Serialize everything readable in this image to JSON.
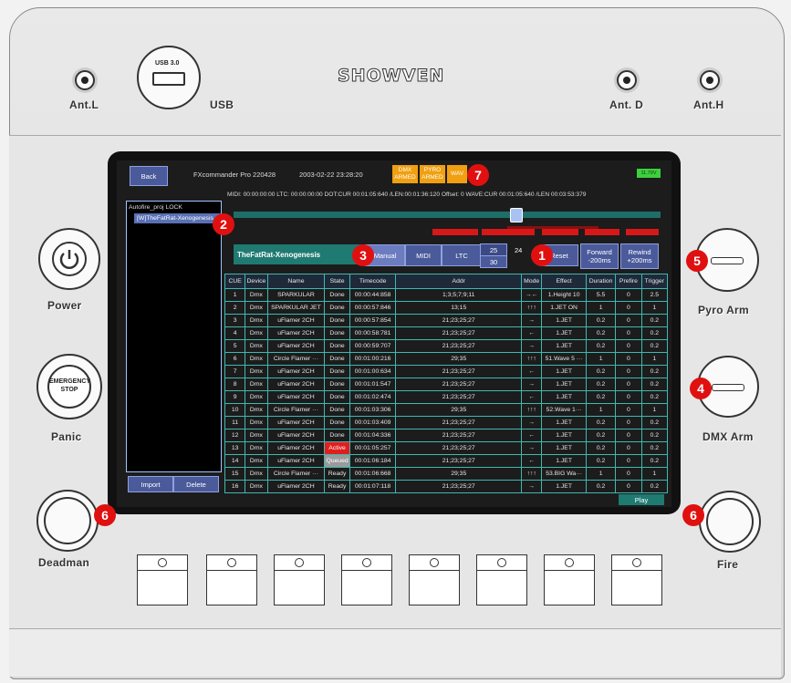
{
  "hardware": {
    "brand": "SHOWVEN",
    "usb_port_text": "USB 3.0",
    "labels": {
      "ant_l": "Ant.L",
      "usb": "USB",
      "ant_d": "Ant. D",
      "ant_h": "Ant.H",
      "power": "Power",
      "panic": "Panic",
      "panic_button_text": "EMERGENCY STOP",
      "deadman": "Deadman",
      "pyro_arm": "Pyro Arm",
      "dmx_arm": "DMX Arm",
      "fire": "Fire"
    },
    "markers": {
      "m1": "1",
      "m2": "2",
      "m3": "3",
      "m4": "4",
      "m5": "5",
      "m6": "6",
      "m7": "7"
    }
  },
  "screen": {
    "back_label": "Back",
    "app_title": "FXcommander Pro 220428",
    "datetime": "2003-02-22 23:28:20",
    "dmx_armed": "DMX ARMED",
    "pyro_armed": "PYRO ARMED",
    "wave": "WAV",
    "battery": "11.79V",
    "status_line": "MIDI: 00:00:00:00  LTC: 00:00:00:00 DOT:CUR 00:01:05:640 /LEN:00:01:36:120  Offset: 0    WAVE:CUR  00:01:05:640 /LEN 00:03:53:379",
    "project": {
      "name": "Autofire_proj",
      "lock": "LOCK",
      "item": "[W]TheFatRat-Xenogenesis"
    },
    "import_label": "Import",
    "delete_label": "Delete",
    "song_title": "TheFatRat-Xenogenesis",
    "modes": {
      "manual": "Manual",
      "midi": "MIDI",
      "ltc": "LTC"
    },
    "fps": {
      "f25": "25",
      "f24": "24",
      "f30": "30"
    },
    "reset_label": "Reset",
    "forward_label_1": "Forward",
    "forward_label_2": "-200ms",
    "rewind_label_1": "Rewind",
    "rewind_label_2": "+200ms",
    "play_label": "Play",
    "playhead_position": 0.66,
    "columns": [
      "CUE",
      "Device",
      "Name",
      "State",
      "Timecode",
      "Addr",
      "Mode",
      "Effect",
      "Duration",
      "Prefire",
      "Trigger"
    ],
    "rows": [
      [
        "1",
        "Dmx",
        "SPARKULAR",
        "Done",
        "00:00:44:858",
        "1;3;5;7;9;11",
        "→←",
        "1.Height 10",
        "5.5",
        "0",
        "2.5"
      ],
      [
        "2",
        "Dmx",
        "SPARKULAR JET",
        "Done",
        "00:00:57:846",
        "13;15",
        "↑↑↑",
        "1.JET ON",
        "1",
        "0",
        "1"
      ],
      [
        "3",
        "Dmx",
        "uFlamer 2CH",
        "Done",
        "00:00:57:854",
        "21;23;25;27",
        "→",
        "1.JET",
        "0.2",
        "0",
        "0.2"
      ],
      [
        "4",
        "Dmx",
        "uFlamer 2CH",
        "Done",
        "00:00:58:781",
        "21;23;25;27",
        "←",
        "1.JET",
        "0.2",
        "0",
        "0.2"
      ],
      [
        "5",
        "Dmx",
        "uFlamer 2CH",
        "Done",
        "00:00:59:707",
        "21;23;25;27",
        "→",
        "1.JET",
        "0.2",
        "0",
        "0.2"
      ],
      [
        "6",
        "Dmx",
        "Circle Flamer ···",
        "Done",
        "00:01:00:216",
        "29;35",
        "↑↑↑",
        "51.Wave 5 ···",
        "1",
        "0",
        "1"
      ],
      [
        "7",
        "Dmx",
        "uFlamer 2CH",
        "Done",
        "00:01:00:634",
        "21;23;25;27",
        "←",
        "1.JET",
        "0.2",
        "0",
        "0.2"
      ],
      [
        "8",
        "Dmx",
        "uFlamer 2CH",
        "Done",
        "00:01:01:547",
        "21;23;25;27",
        "→",
        "1.JET",
        "0.2",
        "0",
        "0.2"
      ],
      [
        "9",
        "Dmx",
        "uFlamer 2CH",
        "Done",
        "00:01:02:474",
        "21;23;25;27",
        "←",
        "1.JET",
        "0.2",
        "0",
        "0.2"
      ],
      [
        "10",
        "Dmx",
        "Circle Flamer ···",
        "Done",
        "00:01:03:306",
        "29;35",
        "↑↑↑",
        "52.Wave 1···",
        "1",
        "0",
        "1"
      ],
      [
        "11",
        "Dmx",
        "uFlamer 2CH",
        "Done",
        "00:01:03:409",
        "21;23;25;27",
        "→",
        "1.JET",
        "0.2",
        "0",
        "0.2"
      ],
      [
        "12",
        "Dmx",
        "uFlamer 2CH",
        "Done",
        "00:01:04:336",
        "21;23;25;27",
        "←",
        "1.JET",
        "0.2",
        "0",
        "0.2"
      ],
      [
        "13",
        "Dmx",
        "uFlamer 2CH",
        "Active",
        "00:01:05:257",
        "21;23;25;27",
        "→",
        "1.JET",
        "0.2",
        "0",
        "0.2"
      ],
      [
        "14",
        "Dmx",
        "uFlamer 2CH",
        "Queued",
        "00:01:06:184",
        "21;23;25;27",
        "←",
        "1.JET",
        "0.2",
        "0",
        "0.2"
      ],
      [
        "15",
        "Dmx",
        "Circle Flamer ···",
        "Ready",
        "00:01:06:668",
        "29;35",
        "↑↑↑",
        "53.BIG Wa···",
        "1",
        "0",
        "1"
      ],
      [
        "16",
        "Dmx",
        "uFlamer 2CH",
        "Ready",
        "00:01:07:118",
        "21;23;25;27",
        "→",
        "1.JET",
        "0.2",
        "0",
        "0.2"
      ]
    ]
  }
}
